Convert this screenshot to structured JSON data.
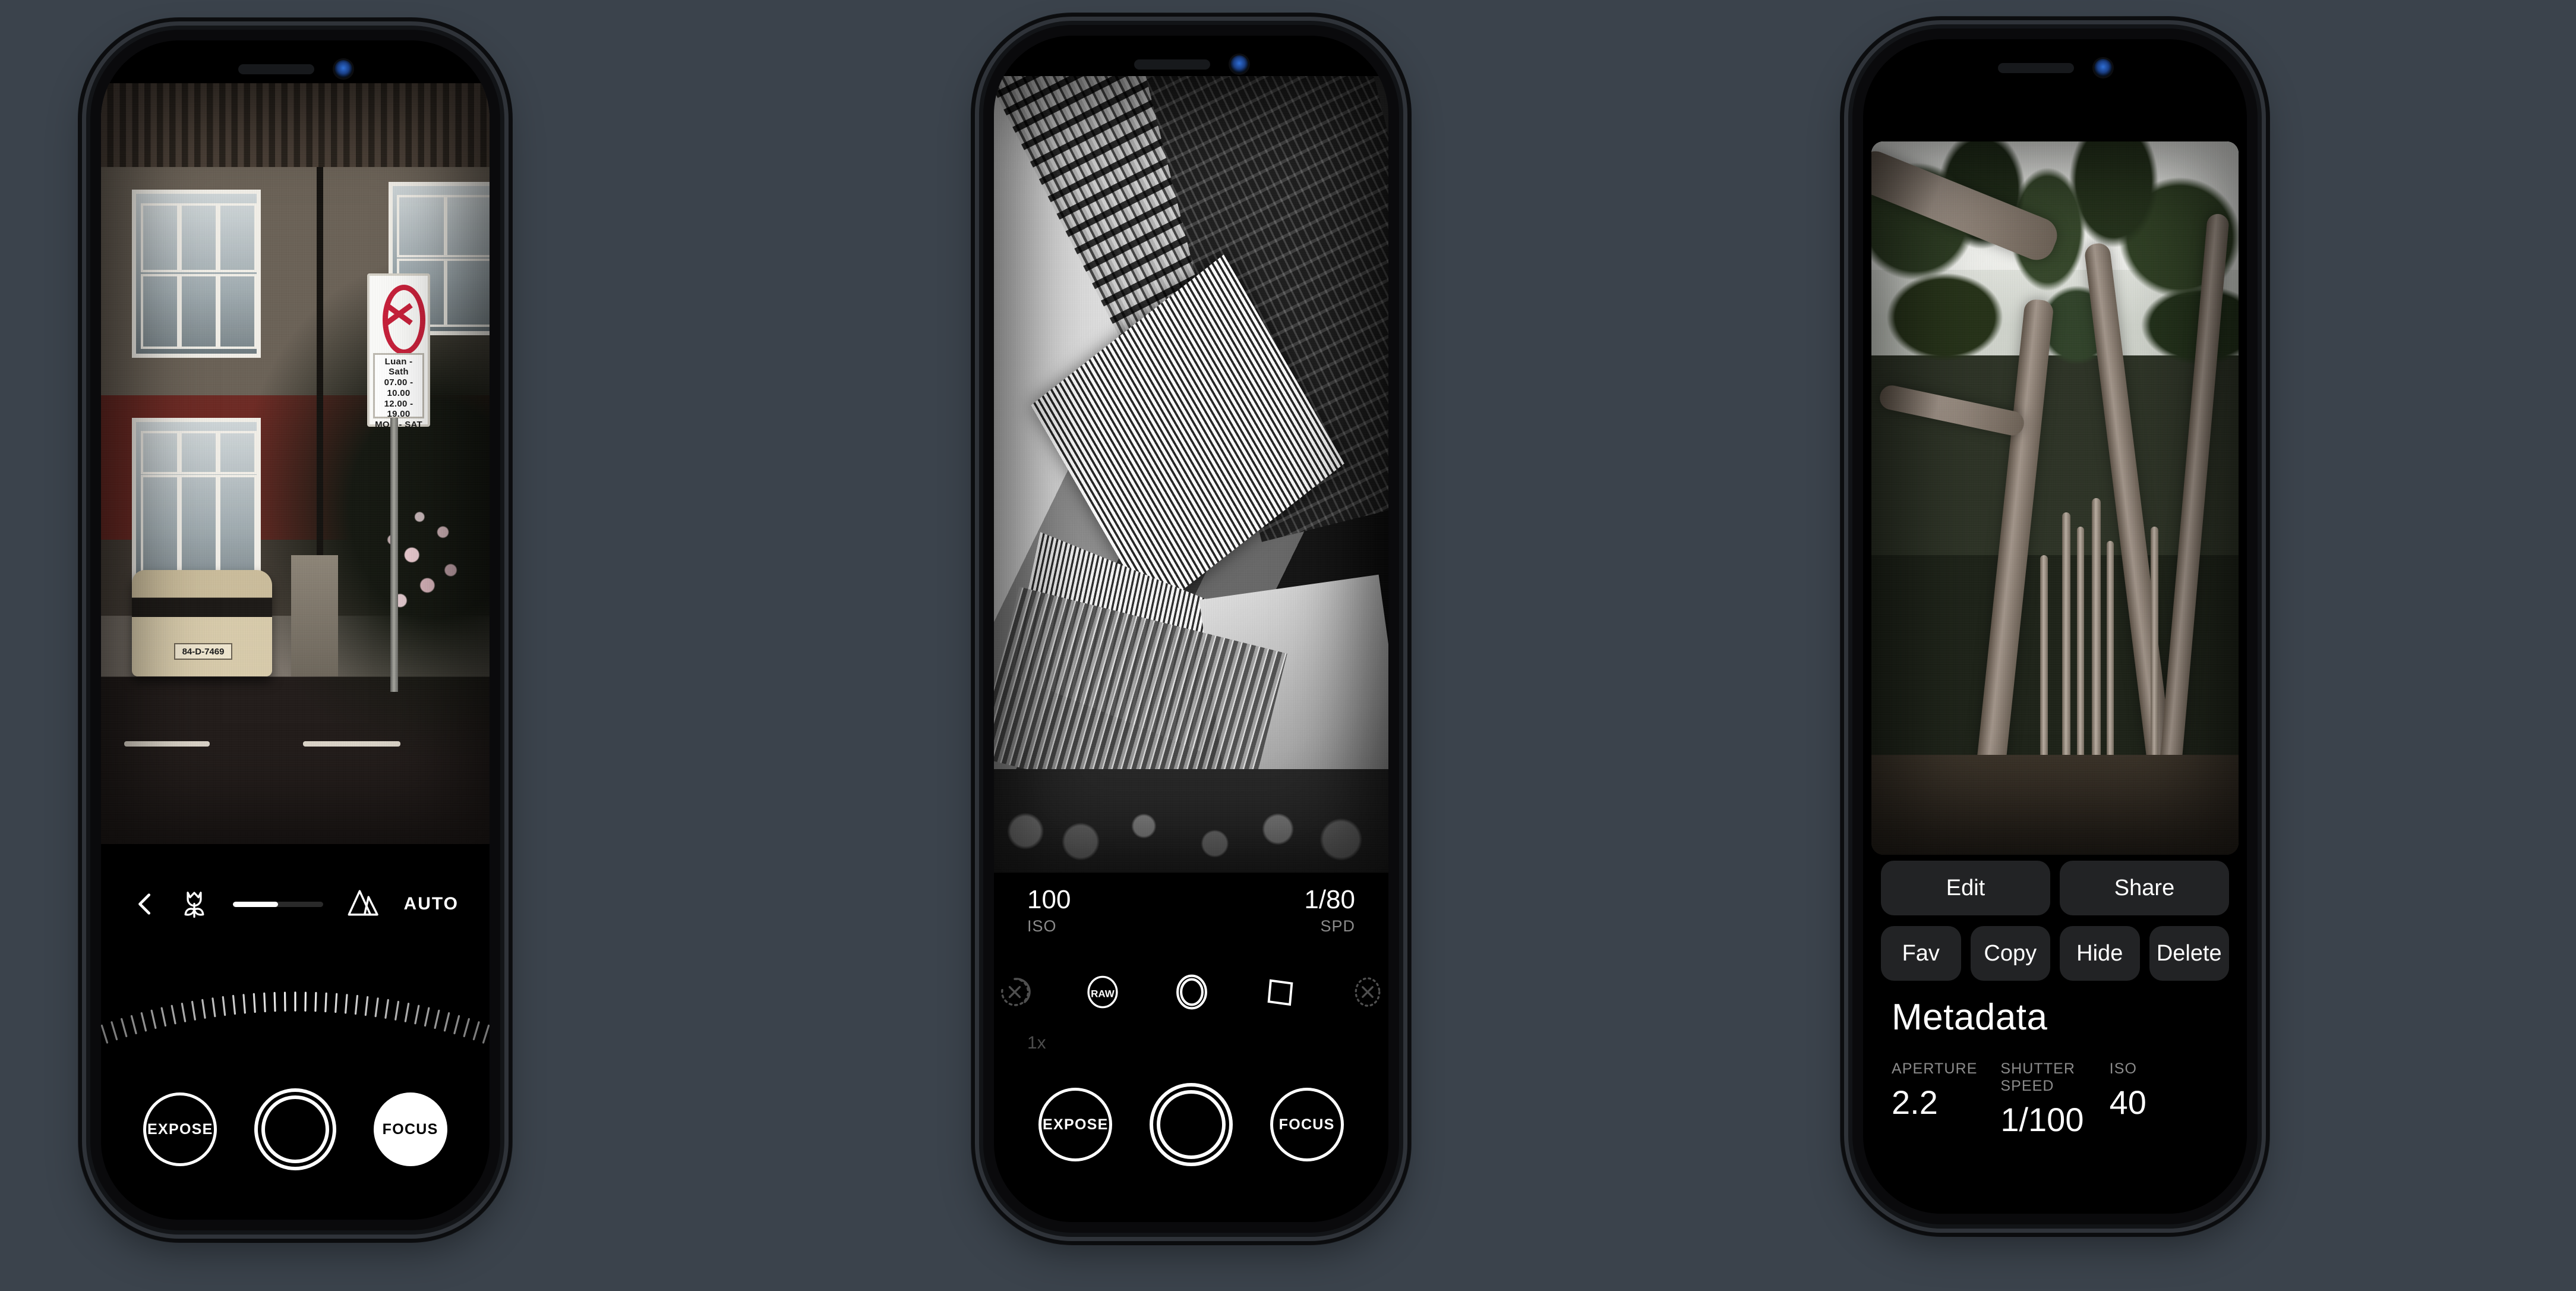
{
  "background_color": "#3b434c",
  "phones": [
    {
      "id": "camera-focus",
      "screen_bg": "#000000",
      "focus_bar": {
        "back_icon": "chevron-left-icon",
        "macro_icon": "tulip-macro-icon",
        "landscape_icon": "mountain-landscape-icon",
        "slider_value_percent": 50,
        "auto_label": "AUTO"
      },
      "controls": [
        {
          "label": "EXPOSE",
          "style": "outline"
        },
        {
          "label": "",
          "style": "shutter"
        },
        {
          "label": "FOCUS",
          "style": "filled"
        }
      ]
    },
    {
      "id": "camera-main",
      "screen_bg": "#000000",
      "exif": [
        {
          "value": "100",
          "key": "ISO",
          "align": "left"
        },
        {
          "value": "1/80",
          "key": "SPD",
          "align": "right"
        }
      ],
      "zoom_label": "1x",
      "mode_icons": [
        {
          "name": "timer-off-icon",
          "label": "",
          "active": false
        },
        {
          "name": "raw-icon",
          "label": "RAW",
          "active": true
        },
        {
          "name": "aperture-lens-icon",
          "label": "",
          "active": true
        },
        {
          "name": "aspect-ratio-icon",
          "label": "",
          "active": true
        },
        {
          "name": "flash-off-icon",
          "label": "",
          "active": false
        }
      ],
      "controls": [
        {
          "label": "EXPOSE",
          "style": "outline"
        },
        {
          "label": "",
          "style": "shutter"
        },
        {
          "label": "FOCUS",
          "style": "outline"
        }
      ]
    },
    {
      "id": "photo-viewer",
      "screen_bg": "#000000",
      "actions_primary": [
        "Edit",
        "Share"
      ],
      "actions_secondary": [
        "Fav",
        "Copy",
        "Hide",
        "Delete"
      ],
      "metadata_title": "Metadata",
      "metadata": [
        {
          "key": "APERTURE",
          "value": "2.2"
        },
        {
          "key": "SHUTTER SPEED",
          "value": "1/100"
        },
        {
          "key": "ISO",
          "value": "40"
        }
      ]
    }
  ],
  "photo1_sign": {
    "line1": "Luan - Sath",
    "line2": "07.00 - 10.00",
    "line3": "12.00 - 19.00",
    "line4": "MON - SAT"
  },
  "photo1_plate": "84-D-7469"
}
